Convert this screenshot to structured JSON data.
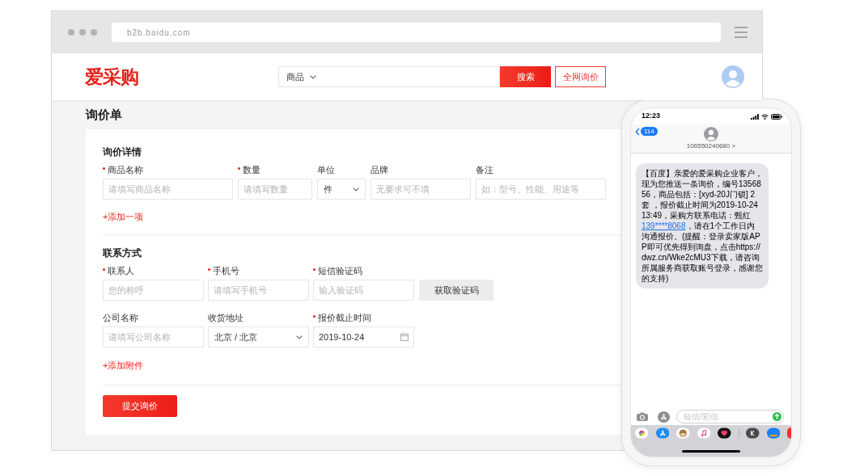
{
  "browser": {
    "url": "b2b.baidu.com"
  },
  "header": {
    "logo": "爱采购",
    "search": {
      "category": "商品",
      "button": "搜索"
    },
    "inquiry_button": "全网询价"
  },
  "page": {
    "title": "询价单"
  },
  "inquiry_details": {
    "title": "询价详情",
    "fields": [
      {
        "label": "商品名称",
        "required": true,
        "kind": "text",
        "placeholder": "请填写商品名称"
      },
      {
        "label": "数量",
        "required": true,
        "kind": "text",
        "placeholder": "请填写数量"
      },
      {
        "label": "单位",
        "required": false,
        "kind": "select",
        "value": "件"
      },
      {
        "label": "品牌",
        "required": false,
        "kind": "text",
        "placeholder": "无要求可不填"
      },
      {
        "label": "备注",
        "required": false,
        "kind": "text",
        "placeholder": "如：型号、性能、用途等"
      }
    ],
    "add_link": "+添加一项"
  },
  "contact": {
    "title": "联系方式",
    "rows": [
      {
        "fields": [
          {
            "label": "联系人",
            "required": true,
            "kind": "text",
            "placeholder": "您的称呼"
          },
          {
            "label": "手机号",
            "required": true,
            "kind": "text",
            "placeholder": "请填写手机号"
          },
          {
            "label": "短信验证码",
            "required": true,
            "kind": "text",
            "placeholder": "输入验证码"
          }
        ],
        "button": "获取验证码"
      },
      {
        "fields": [
          {
            "label": "公司名称",
            "required": false,
            "kind": "text",
            "placeholder": "请填写公司名称"
          },
          {
            "label": "收货地址",
            "required": false,
            "kind": "select",
            "value": "北京 / 北京"
          },
          {
            "label": "报价截止时间",
            "required": true,
            "kind": "date",
            "value": "2019-10-24"
          }
        ]
      }
    ],
    "add_link": "+添加附件"
  },
  "submit_button": "提交询价",
  "phone": {
    "time": "12:23",
    "back_badge": "114",
    "sender": "106550240680 >",
    "message": {
      "before": "【百度】亲爱的爱采购企业客户，现为您推送一条询价，编号1356856，商品包括：[xyd-20J门锁] 2套 ，报价截止时间为2019-10-24 13:49，采购方联系电话：甄红 ",
      "link": "139****8068",
      "after": "，请在1个工作日内沟通报价。(提醒：登录卖家版APP即可优先得到询盘，点击https://dwz.cn/Wke2cMU3下载，请咨询所属服务商获取账号登录，感谢您的支持)"
    },
    "compose": {
      "placeholder": "短信/彩信"
    }
  }
}
